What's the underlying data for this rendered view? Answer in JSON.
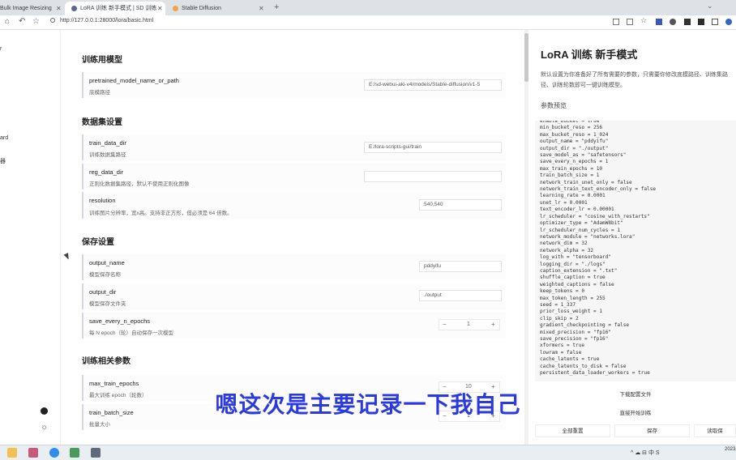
{
  "browser": {
    "tabs": [
      {
        "label": "Bulk Image Resizing",
        "active": false
      },
      {
        "label": "LoRA 训练 新手模式 | SD 训练",
        "active": true
      },
      {
        "label": "Stable Diffusion",
        "active": false
      }
    ],
    "url": "http://127.0.0.1:28000/lora/basic.html"
  },
  "sidebar": {
    "fragments": [
      "r",
      "ard",
      "器"
    ]
  },
  "sections": [
    {
      "title": "训练用模型",
      "rows": [
        {
          "name": "pretrained_model_name_or_path",
          "desc": "底模路径",
          "value": "E:/sd-webui-aki-v4/models/Stable-diffusion/v1-5"
        }
      ]
    },
    {
      "title": "数据集设置",
      "rows": [
        {
          "name": "train_data_dir",
          "desc": "训练数据集路径",
          "value": "E:/lora-scripts-gui/train"
        },
        {
          "name": "reg_data_dir",
          "desc": "正则化数据集路径，默认不使用正则化图像",
          "value": ""
        },
        {
          "name": "resolution",
          "desc": "训练图片分辨率，宽x高。支持非正方形，但必须是 64 倍数。",
          "value": "540,540"
        }
      ]
    },
    {
      "title": "保存设置",
      "rows": [
        {
          "name": "output_name",
          "desc": "模型保存名称",
          "value": "pddyifu"
        },
        {
          "name": "output_dir",
          "desc": "模型保存文件夹",
          "value": "./output"
        },
        {
          "name": "save_every_n_epochs",
          "desc": "每 N epoch（轮）自动保存一次模型",
          "value": "1"
        }
      ]
    },
    {
      "title": "训练相关参数",
      "rows": [
        {
          "name": "max_train_epochs",
          "desc": "最大训练 epoch（轮数）",
          "value": "10"
        },
        {
          "name": "train_batch_size",
          "desc": "批量大小",
          "value": "1"
        }
      ]
    }
  ],
  "stepper": {
    "minus": "−",
    "plus": "+"
  },
  "right_panel": {
    "title": "LoRA 训练 新手模式",
    "desc": "默认设置为你准备好了所有需要的参数，只需要你修改底模路径、训练集路径、训练轮数即可一键训练模型。",
    "preview_label": "参数预览",
    "toml_lines": [
      "enable_bucket = true",
      "min_bucket_reso = 256",
      "max_bucket_reso = 1_024",
      "output_name = \"pddyifu\"",
      "output_dir = \"./output\"",
      "save_model_as = \"safetensors\"",
      "save_every_n_epochs = 1",
      "max_train_epochs = 10",
      "train_batch_size = 1",
      "network_train_unet_only = false",
      "network_train_text_encoder_only = false",
      "learning_rate = 0.0001",
      "unet_lr = 0.0001",
      "text_encoder_lr = 0.00001",
      "lr_scheduler = \"cosine_with_restarts\"",
      "optimizer_type = \"AdamW8bit\"",
      "lr_scheduler_num_cycles = 1",
      "network_module = \"networks.lora\"",
      "network_dim = 32",
      "network_alpha = 32",
      "log_with = \"tensorboard\"",
      "logging_dir = \"./logs\"",
      "caption_extension = \".txt\"",
      "shuffle_caption = true",
      "weighted_captions = false",
      "keep_tokens = 0",
      "max_token_length = 255",
      "seed = 1_337",
      "prior_loss_weight = 1",
      "clip_skip = 2",
      "gradient_checkpointing = false",
      "mixed_precision = \"fp16\"",
      "save_precision = \"fp16\"",
      "xformers = true",
      "lowram = false",
      "cache_latents = true",
      "cache_latents_to_disk = false",
      "persistent_data_loader_workers = true"
    ],
    "buttons": {
      "download": "下载配置文件",
      "start": "直接开始训练",
      "reset": "全部重置",
      "save": "保存",
      "read": "读取保"
    }
  },
  "caption": "嗯这次是主要记录一下我自己",
  "taskbar": {
    "tray": "^ ☁ ⊟ 中 S",
    "clock": "2023"
  }
}
